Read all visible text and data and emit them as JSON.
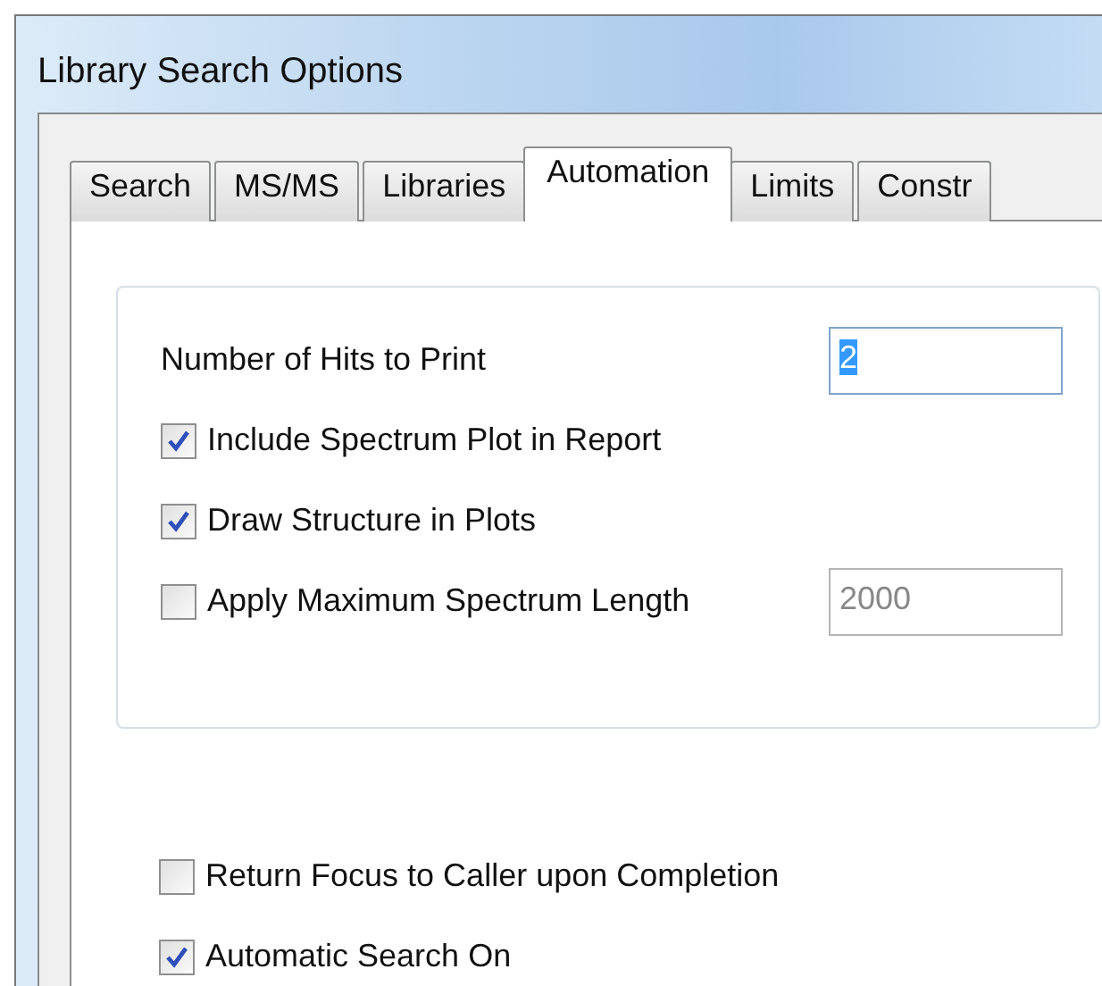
{
  "window": {
    "title": "Library Search Options"
  },
  "tabs": [
    {
      "label": "Search",
      "selected": false
    },
    {
      "label": "MS/MS",
      "selected": false
    },
    {
      "label": "Libraries",
      "selected": false
    },
    {
      "label": "Automation",
      "selected": true
    },
    {
      "label": "Limits",
      "selected": false
    },
    {
      "label": "Constr",
      "selected": false
    }
  ],
  "group": {
    "rows": [
      {
        "kind": "field",
        "label": "Number of Hits to Print",
        "value": "2",
        "text_selected": true,
        "disabled": false
      },
      {
        "kind": "checkbox",
        "label": "Include Spectrum Plot in Report",
        "checked": true
      },
      {
        "kind": "checkbox",
        "label": "Draw Structure in Plots",
        "checked": true
      },
      {
        "kind": "checkbox_field",
        "label": "Apply Maximum Spectrum Length",
        "checked": false,
        "value": "2000",
        "disabled": true
      }
    ]
  },
  "options": [
    {
      "label": "Return Focus to Caller upon Completion",
      "checked": false
    },
    {
      "label": "Automatic Search On",
      "checked": true
    }
  ]
}
